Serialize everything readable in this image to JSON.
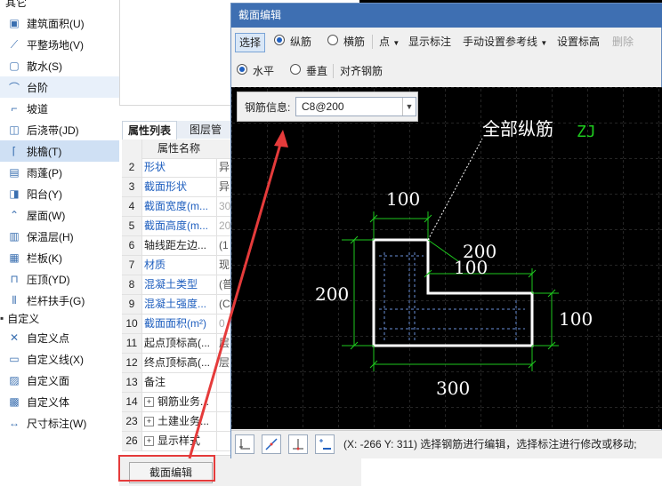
{
  "tree": {
    "top_partial": "其它",
    "items": [
      {
        "label": "建筑面积(U)",
        "icon": "building-area-icon"
      },
      {
        "label": "平整场地(V)",
        "icon": "level-site-icon"
      },
      {
        "label": "散水(S)",
        "icon": "apron-icon"
      },
      {
        "label": "台阶",
        "icon": "steps-icon"
      },
      {
        "label": "坡道",
        "icon": "ramp-icon"
      },
      {
        "label": "后浇带(JD)",
        "icon": "post-cast-strip-icon"
      },
      {
        "label": "挑檐(T)",
        "icon": "cornice-icon"
      },
      {
        "label": "雨蓬(P)",
        "icon": "canopy-icon"
      },
      {
        "label": "阳台(Y)",
        "icon": "balcony-icon"
      },
      {
        "label": "屋面(W)",
        "icon": "roof-icon"
      },
      {
        "label": "保温层(H)",
        "icon": "insulation-icon"
      },
      {
        "label": "栏板(K)",
        "icon": "parapet-icon"
      },
      {
        "label": "压顶(YD)",
        "icon": "coping-icon"
      },
      {
        "label": "栏杆扶手(G)",
        "icon": "railing-icon"
      }
    ],
    "group_custom": "自定义",
    "custom_items": [
      {
        "label": "自定义点",
        "icon": "custom-point-icon"
      },
      {
        "label": "自定义线(X)",
        "icon": "custom-line-icon"
      },
      {
        "label": "自定义面",
        "icon": "custom-face-icon"
      },
      {
        "label": "自定义体",
        "icon": "custom-body-icon"
      },
      {
        "label": "尺寸标注(W)",
        "icon": "dimension-icon"
      }
    ]
  },
  "prop_panel": {
    "tab_props": "属性列表",
    "tab_layers": "图层管理",
    "header_name": "属性名称",
    "rows": [
      {
        "num": "2",
        "name": "形状",
        "value": "异",
        "blue": true
      },
      {
        "num": "3",
        "name": "截面形状",
        "value": "异",
        "blue": true
      },
      {
        "num": "4",
        "name": "截面宽度(m...",
        "value": "30",
        "blue": true,
        "gray": true
      },
      {
        "num": "5",
        "name": "截面高度(m...",
        "value": "20",
        "blue": true,
        "gray": true
      },
      {
        "num": "6",
        "name": "轴线距左边...",
        "value": "(1",
        "blue": false
      },
      {
        "num": "7",
        "name": "材质",
        "value": "现",
        "blue": true
      },
      {
        "num": "8",
        "name": "混凝土类型",
        "value": "(普",
        "blue": true
      },
      {
        "num": "9",
        "name": "混凝土强度...",
        "value": "(C",
        "blue": true
      },
      {
        "num": "10",
        "name": "截面面积(m²)",
        "value": "0",
        "blue": true,
        "gray": true
      },
      {
        "num": "11",
        "name": "起点顶标高(...",
        "value": "层",
        "blue": false
      },
      {
        "num": "12",
        "name": "终点顶标高(...",
        "value": "层",
        "blue": false
      },
      {
        "num": "13",
        "name": "备注",
        "value": "",
        "blue": false
      },
      {
        "num": "14",
        "name": "钢筋业务...",
        "value": "",
        "blue": false,
        "expand": true
      },
      {
        "num": "23",
        "name": "土建业务...",
        "value": "",
        "blue": false,
        "expand": true
      },
      {
        "num": "26",
        "name": "显示样式",
        "value": "",
        "blue": false,
        "expand": true
      }
    ]
  },
  "bottom_button": "截面编辑",
  "dialog": {
    "title": "截面编辑",
    "toolbar1": {
      "select": "选择",
      "longitudinal": "纵筋",
      "transverse": "横筋",
      "point": "点",
      "show_marks": "显示标注",
      "manual_ref": "手动设置参考线",
      "set_elevation": "设置标高",
      "delete": "删除"
    },
    "toolbar2": {
      "horizontal": "水平",
      "vertical": "垂直",
      "align_rebar": "对齐钢筋"
    },
    "rebar_info_label": "钢筋信息:",
    "rebar_info_value": "C8@200",
    "drawing": {
      "all_long_label": "全部纵筋",
      "zj_label": "ZJ",
      "dim_top": "100",
      "dim_left": "200",
      "dim_right_top": "200",
      "dim_inner": "100",
      "dim_right": "100",
      "dim_bottom": "300"
    },
    "status_text": "(X: -266 Y: 311) 选择钢筋进行编辑，选择标注进行修改或移动;"
  },
  "colors": {
    "dialog_title_bg": "#3e6fb2",
    "canvas_bg": "#000000",
    "dim_line": "#1ec81e",
    "section_outline": "#ffffff",
    "highlight": "#e53b3b"
  }
}
